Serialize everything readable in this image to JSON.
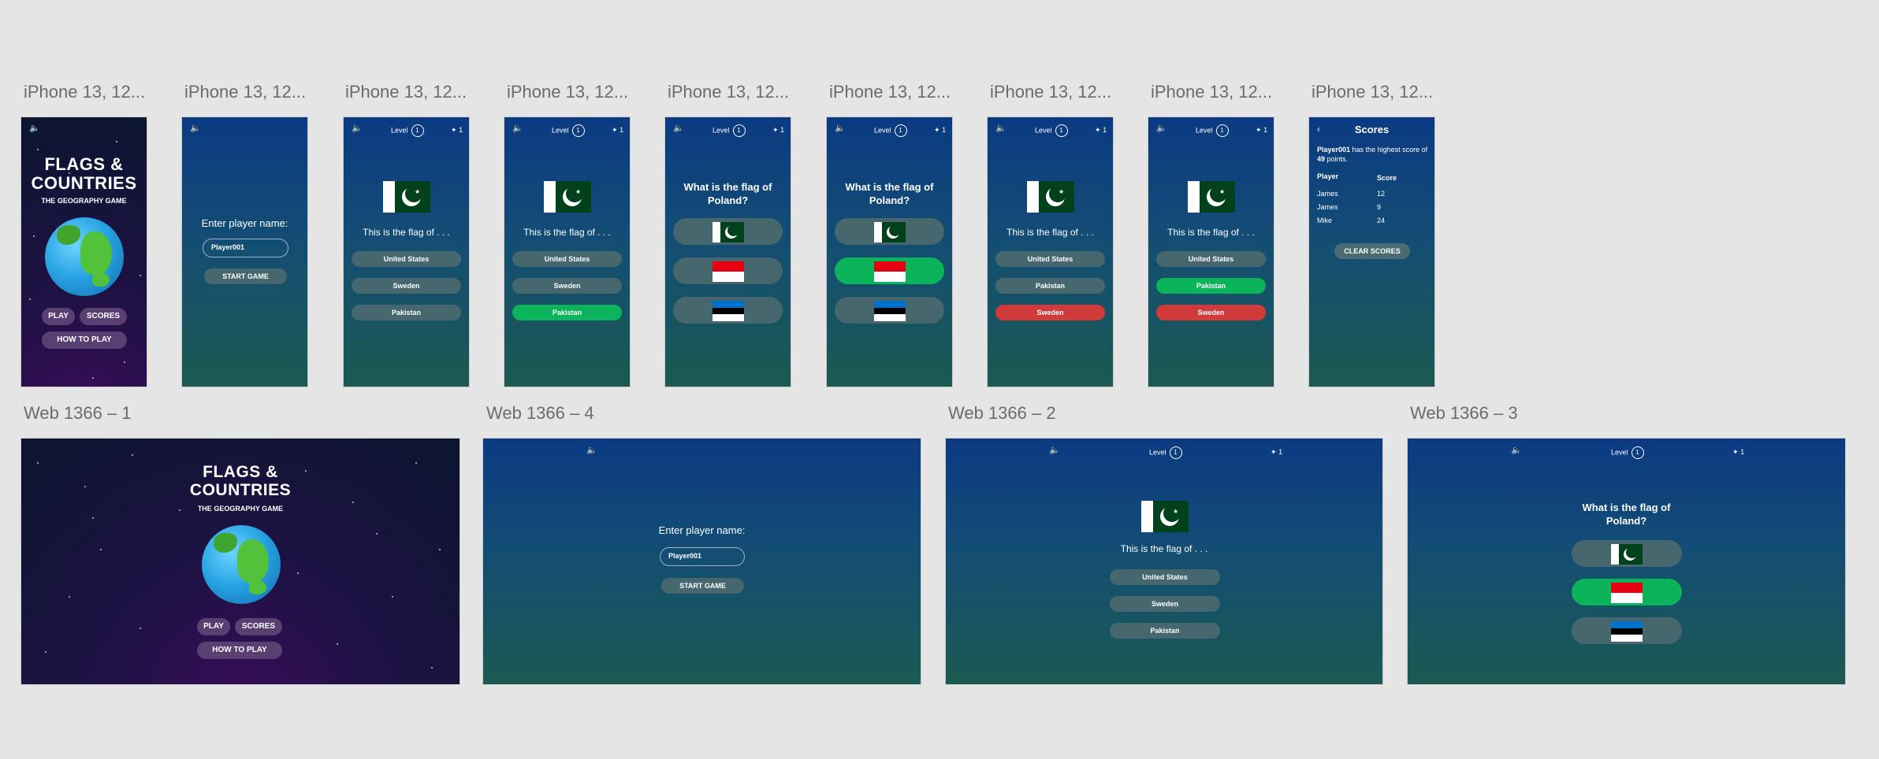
{
  "frames": {
    "iphone_title": "iPhone 13, 12...",
    "web1_title": "Web 1366 – 1",
    "web4_title": "Web 1366 – 4",
    "web2_title": "Web 1366 – 2",
    "web3_title": "Web 1366 – 3"
  },
  "home": {
    "title_line1": "FLAGS &",
    "title_line2": "COUNTRIES",
    "subtitle": "THE GEOGRAPHY GAME",
    "play": "PLAY",
    "scores": "SCORES",
    "how_to_play": "HOW TO PLAY"
  },
  "entry": {
    "prompt": "Enter player name:",
    "input_value": "Player001",
    "start": "START GAME"
  },
  "hud": {
    "level_label": "Level",
    "level_value": "1",
    "lives_value": "1",
    "volume_icon": "speaker-icon",
    "lives_icon": "person-icon"
  },
  "quiz": {
    "statement": "This is the flag of . . .",
    "options_a": [
      "United States",
      "Sweden",
      "Pakistan"
    ],
    "options_b": [
      "United States",
      "Pakistan",
      "Sweden"
    ],
    "question_line1": "What is the flag of",
    "question_line2": "Poland?"
  },
  "scores": {
    "title": "Scores",
    "back_icon": "chevron-left-icon",
    "highscore_player": "Player001",
    "highscore_mid": " has the highest score of ",
    "highscore_points": "49",
    "highscore_tail": " points.",
    "col_player": "Player",
    "col_score": "Score",
    "rows": [
      {
        "player": "James",
        "score": "12"
      },
      {
        "player": "James",
        "score": "9"
      },
      {
        "player": "Mike",
        "score": "24"
      }
    ],
    "clear": "CLEAR SCORES"
  },
  "colors": {
    "correct": "#0bb35a",
    "wrong": "#d03a3a",
    "option": "#45676d",
    "pill": "#5a3f73"
  }
}
